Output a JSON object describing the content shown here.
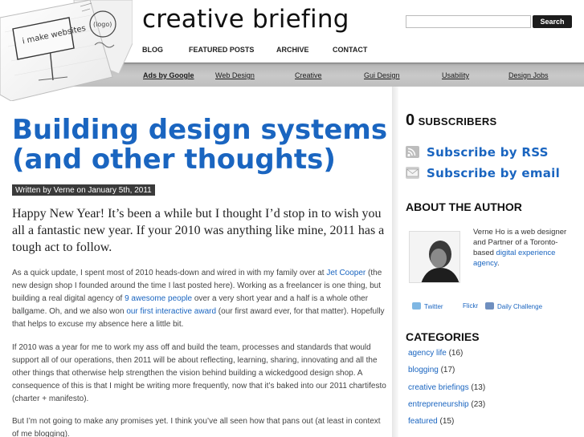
{
  "site": {
    "title": "creative briefing",
    "logo_sign_text": "i make websites",
    "logo_tag_text": "(logo)"
  },
  "search": {
    "placeholder": "",
    "value": "",
    "button_label": "Search"
  },
  "nav": {
    "items": [
      "BLOG",
      "FEATURED POSTS",
      "ARCHIVE",
      "CONTACT"
    ]
  },
  "ads": {
    "title": "Ads by Google",
    "links": [
      "Web Design",
      "Creative",
      "Gui Design",
      "Usability",
      "Design Jobs"
    ]
  },
  "post": {
    "title": "Building design systems (and other thoughts)",
    "meta": "Written by Verne on January 5th, 2011",
    "intro": "Happy New Year! It’s been a while but I thought I’d stop in to wish you all a fantastic new year. If your 2010 was anything like mine, 2011 has a tough act to follow.",
    "p1": {
      "a": "As a quick update, I spent most of 2010 heads-down and wired in with my family over at ",
      "link1": "Jet Cooper",
      "b": " (the new design shop I founded around the time I last posted here). Working as a freelancer is one thing, but building a real digital agency of ",
      "link2": "9 awesome people",
      "c": " over a very short year and a half is a whole other ballgame. Oh, and we also won ",
      "link3": "our first interactive award",
      "d": " (our first award ever, for that matter). Hopefully that helps to excuse my absence here a little bit."
    },
    "p2": "If 2010 was a year for me to work my ass off and build the team, processes and standards that would support all of our operations, then 2011 will be about reflecting, learning, sharing, innovating and all the other things that otherwise help strengthen the vision behind building a wickedgood design shop. A consequence of this is that I might be writing more frequently, now that it’s baked into our 2011 chartifesto (charter + manifesto).",
    "p3": "But I’m not going to make any promises yet. I think you’ve all seen how that pans out (at least in context of me blogging)."
  },
  "sidebar": {
    "subscribers_count": "0",
    "subscribers_label": "SUBSCRIBERS",
    "rss_label": "Subscribe by RSS",
    "email_label": "Subscribe by email",
    "author_heading": "ABOUT THE AUTHOR",
    "author_bio_a": "Verne Ho is a web designer and Partner of a Toronto-based ",
    "author_bio_link": "digital experience agency",
    "author_bio_b": ".",
    "social": {
      "twitter": "Twitter",
      "flickr": "Flickr",
      "daily": "Daily Challenge"
    },
    "categories_heading": "CATEGORIES",
    "categories": [
      {
        "name": "agency life",
        "count": "(16)"
      },
      {
        "name": "blogging",
        "count": "(17)"
      },
      {
        "name": "creative briefings",
        "count": "(13)"
      },
      {
        "name": "entrepreneurship",
        "count": "(23)"
      },
      {
        "name": "featured",
        "count": "(15)"
      }
    ]
  },
  "colors": {
    "link_blue": "#1a65c0",
    "adbar_gray": "#c4c4c4",
    "search_button": "#1c1c1c",
    "meta_badge": "#3a3a3a"
  }
}
